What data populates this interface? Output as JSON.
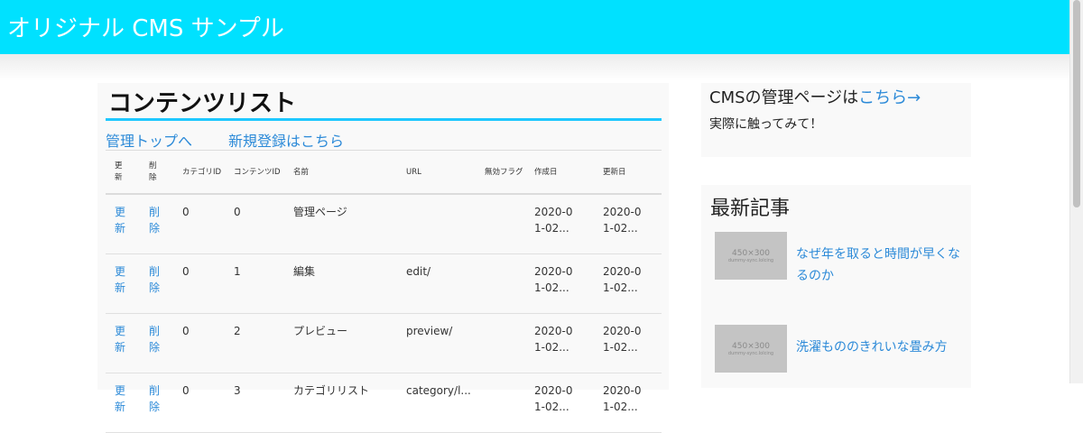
{
  "header": {
    "title": "オリジナル CMS サンプル"
  },
  "main": {
    "title": "コンテンツリスト",
    "links": {
      "admin_top": "管理トップへ",
      "new_entry": "新規登録はこちら"
    },
    "table": {
      "columns": [
        "更新",
        "削除",
        "カテゴリID",
        "コンテンツID",
        "名前",
        "URL",
        "無効フラグ",
        "作成日",
        "更新日"
      ],
      "rows": [
        {
          "update": "更新",
          "delete": "削除",
          "category_id": "0",
          "content_id": "0",
          "name": "管理ページ",
          "url": "",
          "disabled": "",
          "created": "2020-01-02...",
          "updated": "2020-01-02..."
        },
        {
          "update": "更新",
          "delete": "削除",
          "category_id": "0",
          "content_id": "1",
          "name": "編集",
          "url": "edit/",
          "disabled": "",
          "created": "2020-01-02...",
          "updated": "2020-01-02..."
        },
        {
          "update": "更新",
          "delete": "削除",
          "category_id": "0",
          "content_id": "2",
          "name": "プレビュー",
          "url": "preview/",
          "disabled": "",
          "created": "2020-01-02...",
          "updated": "2020-01-02..."
        },
        {
          "update": "更新",
          "delete": "削除",
          "category_id": "0",
          "content_id": "3",
          "name": "カテゴリリスト",
          "url": "category/l...",
          "disabled": "",
          "created": "2020-01-02...",
          "updated": "2020-01-02..."
        }
      ]
    }
  },
  "sidebar": {
    "cms": {
      "text": "CMSの管理ページは",
      "link": "こちら→",
      "sub": "実際に触ってみて！"
    },
    "recent": {
      "title": "最新記事",
      "thumb_label": "450×300",
      "thumb_sub": "dummy-sync.lolcing",
      "articles": [
        {
          "title": "なぜ年を取ると時間が早くなるのか"
        },
        {
          "title": "洗濯もののきれいな畳み方"
        }
      ]
    }
  },
  "colors": {
    "header": "#00e1ff",
    "accent": "#1ec8ff",
    "link": "#2c8ad8"
  }
}
